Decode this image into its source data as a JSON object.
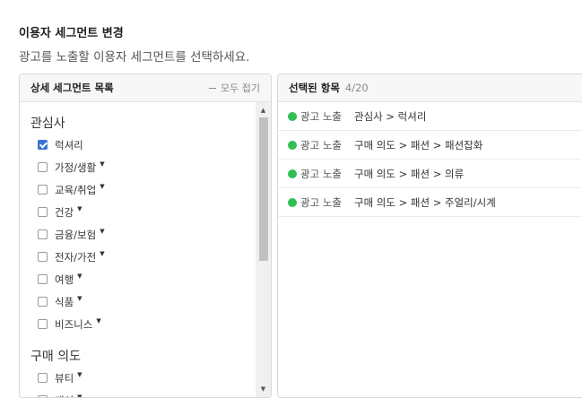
{
  "title": "이용자 세그먼트 변경",
  "description": "광고를 노출할 이용자 세그먼트를 선택하세요.",
  "left_panel": {
    "header": "상세 세그먼트 목록",
    "collapse_label": "모두 접기",
    "groups": [
      {
        "title": "관심사",
        "items": [
          {
            "label": "럭셔리",
            "checked": true,
            "expandable": false
          },
          {
            "label": "가정/생활",
            "checked": false,
            "expandable": true
          },
          {
            "label": "교육/취업",
            "checked": false,
            "expandable": true
          },
          {
            "label": "건강",
            "checked": false,
            "expandable": true
          },
          {
            "label": "금융/보험",
            "checked": false,
            "expandable": true
          },
          {
            "label": "전자/가전",
            "checked": false,
            "expandable": true
          },
          {
            "label": "여행",
            "checked": false,
            "expandable": true
          },
          {
            "label": "식품",
            "checked": false,
            "expandable": true
          },
          {
            "label": "비즈니스",
            "checked": false,
            "expandable": true
          }
        ]
      },
      {
        "title": "구매 의도",
        "items": [
          {
            "label": "뷰티",
            "checked": false,
            "expandable": true
          },
          {
            "label": "패션",
            "checked": false,
            "expandable": true
          }
        ]
      }
    ]
  },
  "right_panel": {
    "header": "선택된 항목",
    "count": "4/20",
    "selected": [
      {
        "type": "광고 노출",
        "path": "관심사 > 럭셔리"
      },
      {
        "type": "광고 노출",
        "path": "구매 의도 > 패션 > 패션잡화"
      },
      {
        "type": "광고 노출",
        "path": "구매 의도 > 패션 > 의류"
      },
      {
        "type": "광고 노출",
        "path": "구매 의도 > 패션 > 주얼리/시계"
      }
    ]
  },
  "colors": {
    "accent": "#3b73d4",
    "status_dot": "#2fbf55"
  }
}
